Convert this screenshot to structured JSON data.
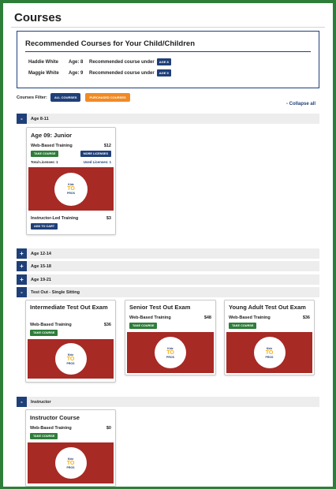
{
  "page": {
    "title": "Courses"
  },
  "recommended": {
    "title": "Recommended Courses for Your Child/Children",
    "children": [
      {
        "name": "Haddie White",
        "age": "Age: 8",
        "text": "Recommended course under",
        "badge": "AGE 8"
      },
      {
        "name": "Maggie White",
        "age": "Age: 9",
        "text": "Recommended course under",
        "badge": "AGE 9"
      }
    ]
  },
  "filter": {
    "label": "Courses Filter:",
    "all": "ALL COURSES",
    "purchased": "PURCHASED COURSES"
  },
  "collapse_all": "- Collapse all",
  "sections": [
    {
      "toggle": "-",
      "label": "Age 8-11"
    },
    {
      "toggle": "+",
      "label": "Age 12-14"
    },
    {
      "toggle": "+",
      "label": "Age 15-18"
    },
    {
      "toggle": "+",
      "label": "Age 19-21"
    },
    {
      "toggle": "-",
      "label": "Test Out - Single Sitting"
    },
    {
      "toggle": "-",
      "label": "Instructor"
    }
  ],
  "junior_card": {
    "title": "Age 09: Junior",
    "web_label": "Web-Based Training",
    "web_price": "$12",
    "take_course": "TAKE COURSE",
    "more_licenses": "MORE LICENSES",
    "total_licenses": "Total Licenses: 1",
    "used_licenses": "Used Licenses: 1",
    "led_label": "Instructor-Led Training",
    "led_price": "$3",
    "add_to_cart": "ADD TO CART"
  },
  "test_out_cards": [
    {
      "title": "Intermediate Test Out Exam",
      "label": "Web-Based Training",
      "price": "$36",
      "button": "TAKE COURSE"
    },
    {
      "title": "Senior Test Out Exam",
      "label": "Web-Based Training",
      "price": "$48",
      "button": "TAKE COURSE"
    },
    {
      "title": "Young Adult Test Out Exam",
      "label": "Web-Based Training",
      "price": "$36",
      "button": "TAKE COURSE"
    }
  ],
  "instructor_card": {
    "title": "Instructor Course",
    "label": "Web-Based Training",
    "price": "$0",
    "button": "TAKE COURSE"
  },
  "logo": {
    "top": "Kidz",
    "big": "TO",
    "bottom": "PROS"
  },
  "colors": {
    "navy": "#1f3f78",
    "green": "#2e7d3a",
    "orange": "#f08a24",
    "course_red": "#a72a25",
    "frame_green": "#2e7d3a"
  }
}
